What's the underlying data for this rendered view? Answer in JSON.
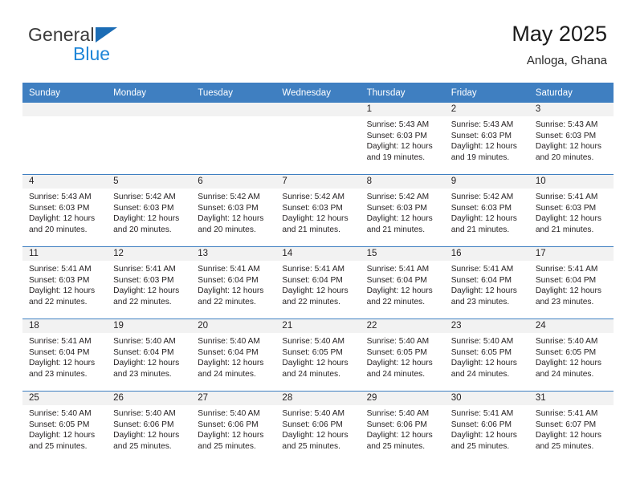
{
  "brand": {
    "name_part1": "General",
    "name_part2": "Blue",
    "triangle_color": "#1b6cb5",
    "blue_text_color": "#1f86d8"
  },
  "header": {
    "title": "May 2025",
    "subtitle": "Anloga, Ghana"
  },
  "theme": {
    "header_bg": "#3f7fc1",
    "header_text": "#ffffff",
    "date_bar_bg": "#f2f2f2",
    "cell_bg": "#ffffff",
    "text": "#231f20"
  },
  "weekday_headers": [
    "Sunday",
    "Monday",
    "Tuesday",
    "Wednesday",
    "Thursday",
    "Friday",
    "Saturday"
  ],
  "weeks": [
    [
      {
        "day": "",
        "empty": true,
        "sunrise": "",
        "sunset": "",
        "daylight_line1": "",
        "daylight_line2": ""
      },
      {
        "day": "",
        "empty": true,
        "sunrise": "",
        "sunset": "",
        "daylight_line1": "",
        "daylight_line2": ""
      },
      {
        "day": "",
        "empty": true,
        "sunrise": "",
        "sunset": "",
        "daylight_line1": "",
        "daylight_line2": ""
      },
      {
        "day": "",
        "empty": true,
        "sunrise": "",
        "sunset": "",
        "daylight_line1": "",
        "daylight_line2": ""
      },
      {
        "day": "1",
        "empty": false,
        "sunrise": "Sunrise: 5:43 AM",
        "sunset": "Sunset: 6:03 PM",
        "daylight_line1": "Daylight: 12 hours",
        "daylight_line2": "and 19 minutes."
      },
      {
        "day": "2",
        "empty": false,
        "sunrise": "Sunrise: 5:43 AM",
        "sunset": "Sunset: 6:03 PM",
        "daylight_line1": "Daylight: 12 hours",
        "daylight_line2": "and 19 minutes."
      },
      {
        "day": "3",
        "empty": false,
        "sunrise": "Sunrise: 5:43 AM",
        "sunset": "Sunset: 6:03 PM",
        "daylight_line1": "Daylight: 12 hours",
        "daylight_line2": "and 20 minutes."
      }
    ],
    [
      {
        "day": "4",
        "empty": false,
        "sunrise": "Sunrise: 5:43 AM",
        "sunset": "Sunset: 6:03 PM",
        "daylight_line1": "Daylight: 12 hours",
        "daylight_line2": "and 20 minutes."
      },
      {
        "day": "5",
        "empty": false,
        "sunrise": "Sunrise: 5:42 AM",
        "sunset": "Sunset: 6:03 PM",
        "daylight_line1": "Daylight: 12 hours",
        "daylight_line2": "and 20 minutes."
      },
      {
        "day": "6",
        "empty": false,
        "sunrise": "Sunrise: 5:42 AM",
        "sunset": "Sunset: 6:03 PM",
        "daylight_line1": "Daylight: 12 hours",
        "daylight_line2": "and 20 minutes."
      },
      {
        "day": "7",
        "empty": false,
        "sunrise": "Sunrise: 5:42 AM",
        "sunset": "Sunset: 6:03 PM",
        "daylight_line1": "Daylight: 12 hours",
        "daylight_line2": "and 21 minutes."
      },
      {
        "day": "8",
        "empty": false,
        "sunrise": "Sunrise: 5:42 AM",
        "sunset": "Sunset: 6:03 PM",
        "daylight_line1": "Daylight: 12 hours",
        "daylight_line2": "and 21 minutes."
      },
      {
        "day": "9",
        "empty": false,
        "sunrise": "Sunrise: 5:42 AM",
        "sunset": "Sunset: 6:03 PM",
        "daylight_line1": "Daylight: 12 hours",
        "daylight_line2": "and 21 minutes."
      },
      {
        "day": "10",
        "empty": false,
        "sunrise": "Sunrise: 5:41 AM",
        "sunset": "Sunset: 6:03 PM",
        "daylight_line1": "Daylight: 12 hours",
        "daylight_line2": "and 21 minutes."
      }
    ],
    [
      {
        "day": "11",
        "empty": false,
        "sunrise": "Sunrise: 5:41 AM",
        "sunset": "Sunset: 6:03 PM",
        "daylight_line1": "Daylight: 12 hours",
        "daylight_line2": "and 22 minutes."
      },
      {
        "day": "12",
        "empty": false,
        "sunrise": "Sunrise: 5:41 AM",
        "sunset": "Sunset: 6:03 PM",
        "daylight_line1": "Daylight: 12 hours",
        "daylight_line2": "and 22 minutes."
      },
      {
        "day": "13",
        "empty": false,
        "sunrise": "Sunrise: 5:41 AM",
        "sunset": "Sunset: 6:04 PM",
        "daylight_line1": "Daylight: 12 hours",
        "daylight_line2": "and 22 minutes."
      },
      {
        "day": "14",
        "empty": false,
        "sunrise": "Sunrise: 5:41 AM",
        "sunset": "Sunset: 6:04 PM",
        "daylight_line1": "Daylight: 12 hours",
        "daylight_line2": "and 22 minutes."
      },
      {
        "day": "15",
        "empty": false,
        "sunrise": "Sunrise: 5:41 AM",
        "sunset": "Sunset: 6:04 PM",
        "daylight_line1": "Daylight: 12 hours",
        "daylight_line2": "and 22 minutes."
      },
      {
        "day": "16",
        "empty": false,
        "sunrise": "Sunrise: 5:41 AM",
        "sunset": "Sunset: 6:04 PM",
        "daylight_line1": "Daylight: 12 hours",
        "daylight_line2": "and 23 minutes."
      },
      {
        "day": "17",
        "empty": false,
        "sunrise": "Sunrise: 5:41 AM",
        "sunset": "Sunset: 6:04 PM",
        "daylight_line1": "Daylight: 12 hours",
        "daylight_line2": "and 23 minutes."
      }
    ],
    [
      {
        "day": "18",
        "empty": false,
        "sunrise": "Sunrise: 5:41 AM",
        "sunset": "Sunset: 6:04 PM",
        "daylight_line1": "Daylight: 12 hours",
        "daylight_line2": "and 23 minutes."
      },
      {
        "day": "19",
        "empty": false,
        "sunrise": "Sunrise: 5:40 AM",
        "sunset": "Sunset: 6:04 PM",
        "daylight_line1": "Daylight: 12 hours",
        "daylight_line2": "and 23 minutes."
      },
      {
        "day": "20",
        "empty": false,
        "sunrise": "Sunrise: 5:40 AM",
        "sunset": "Sunset: 6:04 PM",
        "daylight_line1": "Daylight: 12 hours",
        "daylight_line2": "and 24 minutes."
      },
      {
        "day": "21",
        "empty": false,
        "sunrise": "Sunrise: 5:40 AM",
        "sunset": "Sunset: 6:05 PM",
        "daylight_line1": "Daylight: 12 hours",
        "daylight_line2": "and 24 minutes."
      },
      {
        "day": "22",
        "empty": false,
        "sunrise": "Sunrise: 5:40 AM",
        "sunset": "Sunset: 6:05 PM",
        "daylight_line1": "Daylight: 12 hours",
        "daylight_line2": "and 24 minutes."
      },
      {
        "day": "23",
        "empty": false,
        "sunrise": "Sunrise: 5:40 AM",
        "sunset": "Sunset: 6:05 PM",
        "daylight_line1": "Daylight: 12 hours",
        "daylight_line2": "and 24 minutes."
      },
      {
        "day": "24",
        "empty": false,
        "sunrise": "Sunrise: 5:40 AM",
        "sunset": "Sunset: 6:05 PM",
        "daylight_line1": "Daylight: 12 hours",
        "daylight_line2": "and 24 minutes."
      }
    ],
    [
      {
        "day": "25",
        "empty": false,
        "sunrise": "Sunrise: 5:40 AM",
        "sunset": "Sunset: 6:05 PM",
        "daylight_line1": "Daylight: 12 hours",
        "daylight_line2": "and 25 minutes."
      },
      {
        "day": "26",
        "empty": false,
        "sunrise": "Sunrise: 5:40 AM",
        "sunset": "Sunset: 6:06 PM",
        "daylight_line1": "Daylight: 12 hours",
        "daylight_line2": "and 25 minutes."
      },
      {
        "day": "27",
        "empty": false,
        "sunrise": "Sunrise: 5:40 AM",
        "sunset": "Sunset: 6:06 PM",
        "daylight_line1": "Daylight: 12 hours",
        "daylight_line2": "and 25 minutes."
      },
      {
        "day": "28",
        "empty": false,
        "sunrise": "Sunrise: 5:40 AM",
        "sunset": "Sunset: 6:06 PM",
        "daylight_line1": "Daylight: 12 hours",
        "daylight_line2": "and 25 minutes."
      },
      {
        "day": "29",
        "empty": false,
        "sunrise": "Sunrise: 5:40 AM",
        "sunset": "Sunset: 6:06 PM",
        "daylight_line1": "Daylight: 12 hours",
        "daylight_line2": "and 25 minutes."
      },
      {
        "day": "30",
        "empty": false,
        "sunrise": "Sunrise: 5:41 AM",
        "sunset": "Sunset: 6:06 PM",
        "daylight_line1": "Daylight: 12 hours",
        "daylight_line2": "and 25 minutes."
      },
      {
        "day": "31",
        "empty": false,
        "sunrise": "Sunrise: 5:41 AM",
        "sunset": "Sunset: 6:07 PM",
        "daylight_line1": "Daylight: 12 hours",
        "daylight_line2": "and 25 minutes."
      }
    ]
  ]
}
